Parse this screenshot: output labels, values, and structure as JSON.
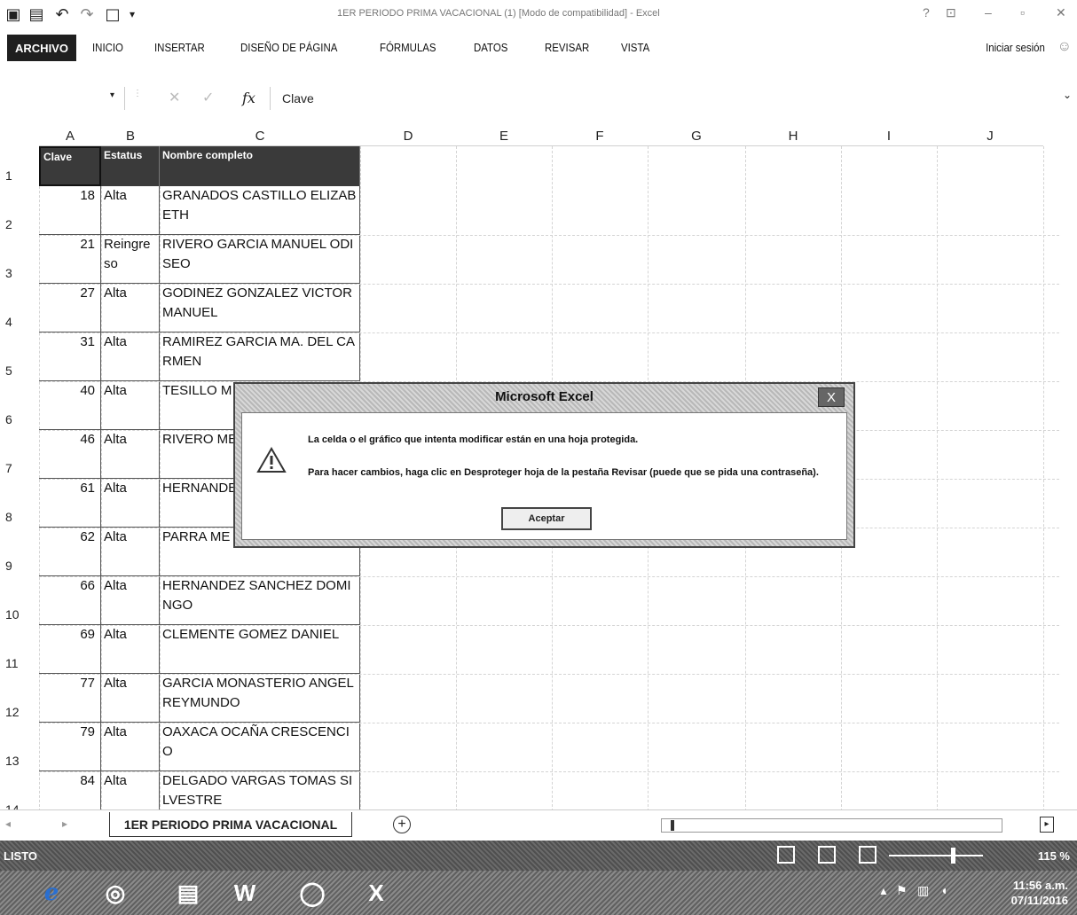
{
  "titlebar": {
    "title": "1ER PERIODO PRIMA VACACIONAL (1) [Modo de compatibilidad] - Excel",
    "help": "?",
    "minimize": "–",
    "restore": "▫",
    "close": "✕"
  },
  "ribbon": {
    "tabs": [
      "ARCHIVO",
      "INICIO",
      "INSERTAR",
      "DISEÑO DE PÁGINA",
      "FÓRMULAS",
      "DATOS",
      "REVISAR",
      "VISTA"
    ],
    "signin": "Iniciar sesión"
  },
  "formula_bar": {
    "fx": "fx",
    "value": "Clave"
  },
  "grid": {
    "columns": [
      "A",
      "B",
      "C",
      "D",
      "E",
      "F",
      "G",
      "H",
      "I",
      "J"
    ],
    "rows": [
      "1",
      "2",
      "3",
      "4",
      "5",
      "6",
      "7",
      "8",
      "9",
      "10",
      "11",
      "12",
      "13",
      "14"
    ],
    "header": {
      "clave": "Clave",
      "estatus": "Estatus",
      "nombre": "Nombre completo"
    },
    "records": [
      {
        "clave": "18",
        "estatus": "Alta",
        "nombre": "GRANADOS CASTILLO ELIZABETH"
      },
      {
        "clave": "21",
        "estatus": "Reingreso",
        "nombre": "RIVERO GARCIA MANUEL ODISEO"
      },
      {
        "clave": "27",
        "estatus": "Alta",
        "nombre": "GODINEZ GONZALEZ VICTOR MANUEL"
      },
      {
        "clave": "31",
        "estatus": "Alta",
        "nombre": "RAMIREZ GARCIA MA. DEL CARMEN"
      },
      {
        "clave": "40",
        "estatus": "Alta",
        "nombre": "TESILLO M FRANCISCO"
      },
      {
        "clave": "46",
        "estatus": "Alta",
        "nombre": "RIVERO ME"
      },
      {
        "clave": "61",
        "estatus": "Alta",
        "nombre": "HERNANDE ANTONIO"
      },
      {
        "clave": "62",
        "estatus": "Alta",
        "nombre": "PARRA ME"
      },
      {
        "clave": "66",
        "estatus": "Alta",
        "nombre": "HERNANDEZ SANCHEZ DOMINGO"
      },
      {
        "clave": "69",
        "estatus": "Alta",
        "nombre": "CLEMENTE GOMEZ DANIEL"
      },
      {
        "clave": "77",
        "estatus": "Alta",
        "nombre": "GARCIA MONASTERIO ANGEL REYMUNDO"
      },
      {
        "clave": "79",
        "estatus": "Alta",
        "nombre": "OAXACA OCAÑA CRESCENCIO"
      },
      {
        "clave": "84",
        "estatus": "Alta",
        "nombre": "DELGADO VARGAS TOMAS SILVESTRE"
      }
    ]
  },
  "sheets": {
    "active": "1ER PERIODO PRIMA VACACIONAL",
    "add": "+"
  },
  "statusbar": {
    "status": "LISTO",
    "zoom": "115 %"
  },
  "taskbar": {
    "time": "11:56 a.m.",
    "date": "07/11/2016"
  },
  "dialog": {
    "title": "Microsoft Excel",
    "close": "X",
    "message1": "La celda o el gráfico que intenta modificar están en una hoja protegida.",
    "message2": "Para hacer cambios, haga clic en Desproteger hoja de la pestaña Revisar (puede que se pida una contraseña).",
    "ok": "Aceptar"
  }
}
